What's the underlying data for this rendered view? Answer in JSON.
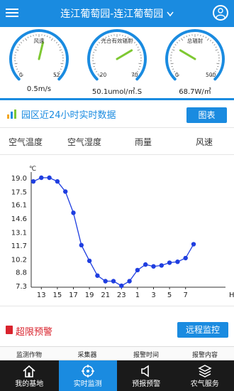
{
  "header": {
    "title": "连江葡萄园-连江葡萄园",
    "dropdown_icon": "chevron-down-icon",
    "menu_icon": "menu-icon",
    "user_icon": "user-icon"
  },
  "gauges": [
    {
      "name": "风速",
      "min": "0",
      "max": "52",
      "value_text": "0.5m/s",
      "level": 0.55
    },
    {
      "name": "光合有效辐射",
      "min": "-20",
      "max": "70",
      "value_text": "50.1umol/㎡.S",
      "level": 0.72
    },
    {
      "name": "总辐射",
      "min": "0",
      "max": "500",
      "value_text": "68.7W/㎡",
      "level": 0.28
    }
  ],
  "section": {
    "title": "园区近24小时实时数据",
    "chart_button": "图表",
    "icon": "chart-icon"
  },
  "tabs": [
    "空气温度",
    "空气湿度",
    "雨量",
    "风速"
  ],
  "chart_data": {
    "type": "line",
    "unit_label": "℃",
    "x_unit": "H",
    "y_ticks": [
      "19.0",
      "17.5",
      "16.1",
      "14.6",
      "13.1",
      "11.7",
      "10.2",
      "8.8",
      "7.3"
    ],
    "ylim": [
      7.3,
      19.0
    ],
    "x_ticks": [
      "13",
      "15",
      "17",
      "19",
      "21",
      "23",
      "1",
      "3",
      "5",
      "7"
    ],
    "series": [
      {
        "color": "#1f3ee0",
        "values": [
          18.6,
          19.0,
          19.0,
          18.6,
          17.5,
          15.2,
          11.7,
          10.0,
          8.4,
          7.8,
          7.8,
          7.3,
          7.8,
          9.0,
          9.6,
          9.4,
          9.5,
          9.8,
          9.9,
          10.3,
          11.8
        ]
      }
    ]
  },
  "alarm": {
    "title": "超限预警",
    "remote_button": "远程监控",
    "icon": "alarm-icon"
  },
  "table_headers": [
    "监测作物",
    "采集器",
    "报警时间",
    "报警内容"
  ],
  "bottom_nav": [
    {
      "label": "我的基地",
      "icon": "home-icon",
      "active": false
    },
    {
      "label": "实时监测",
      "icon": "target-icon",
      "active": true
    },
    {
      "label": "预报预警",
      "icon": "speaker-icon",
      "active": false
    },
    {
      "label": "农气服务",
      "icon": "layers-icon",
      "active": false
    }
  ],
  "colors": {
    "primary": "#1a8be0",
    "alarm": "#d9232d",
    "nav_bg": "#1a1a1a",
    "gauge_green": "#7ec832"
  }
}
